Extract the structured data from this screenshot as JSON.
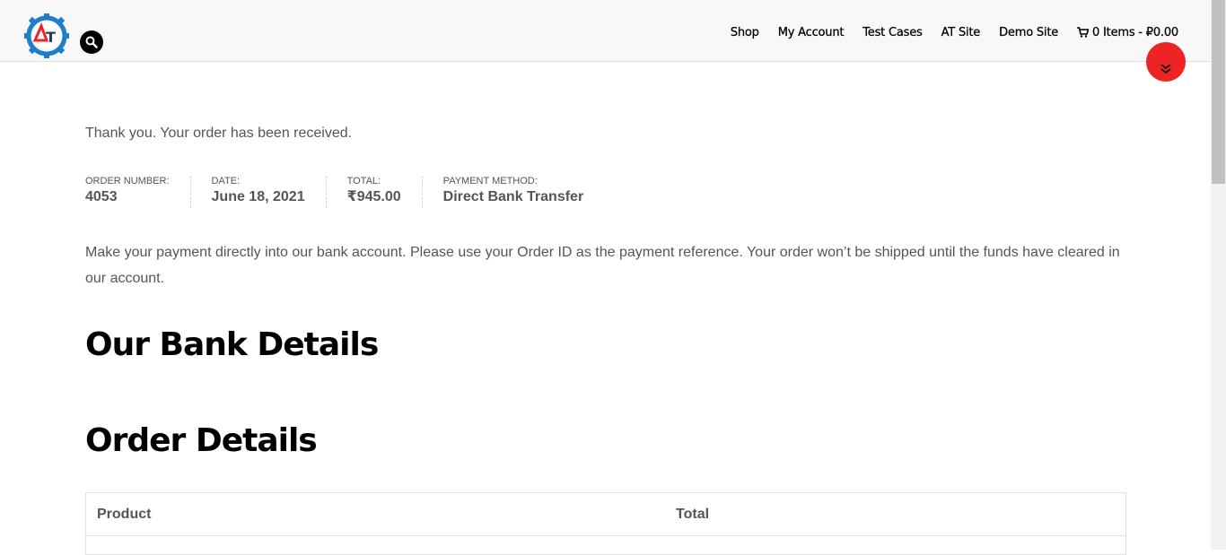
{
  "header": {
    "logo_text": "AT",
    "nav": [
      {
        "label": "Shop"
      },
      {
        "label": "My Account"
      },
      {
        "label": "Test Cases"
      },
      {
        "label": "AT Site"
      },
      {
        "label": "Demo Site"
      }
    ],
    "cart": {
      "label": "0 Items - ₽0.00",
      "icon": "cart-icon"
    },
    "search_icon": "search-icon"
  },
  "main": {
    "thankyou": "Thank you. Your order has been received.",
    "overview": [
      {
        "label": "ORDER NUMBER:",
        "value": "4053"
      },
      {
        "label": "DATE:",
        "value": "June 18, 2021"
      },
      {
        "label": "TOTAL:",
        "value": "₹945.00"
      },
      {
        "label": "PAYMENT METHOD:",
        "value": "Direct Bank Transfer"
      }
    ],
    "instructions": "Make your payment directly into our bank account. Please use your Order ID as the payment reference. Your order won’t be shipped until the funds have cleared in our account.",
    "bank_heading": "Our Bank Details",
    "order_heading": "Order Details",
    "table": {
      "columns": [
        "Product",
        "Total"
      ]
    }
  },
  "colors": {
    "accent": "#ee2424",
    "logo_blue": "#1e7fc9",
    "text": "#555555",
    "heading": "#000000"
  }
}
